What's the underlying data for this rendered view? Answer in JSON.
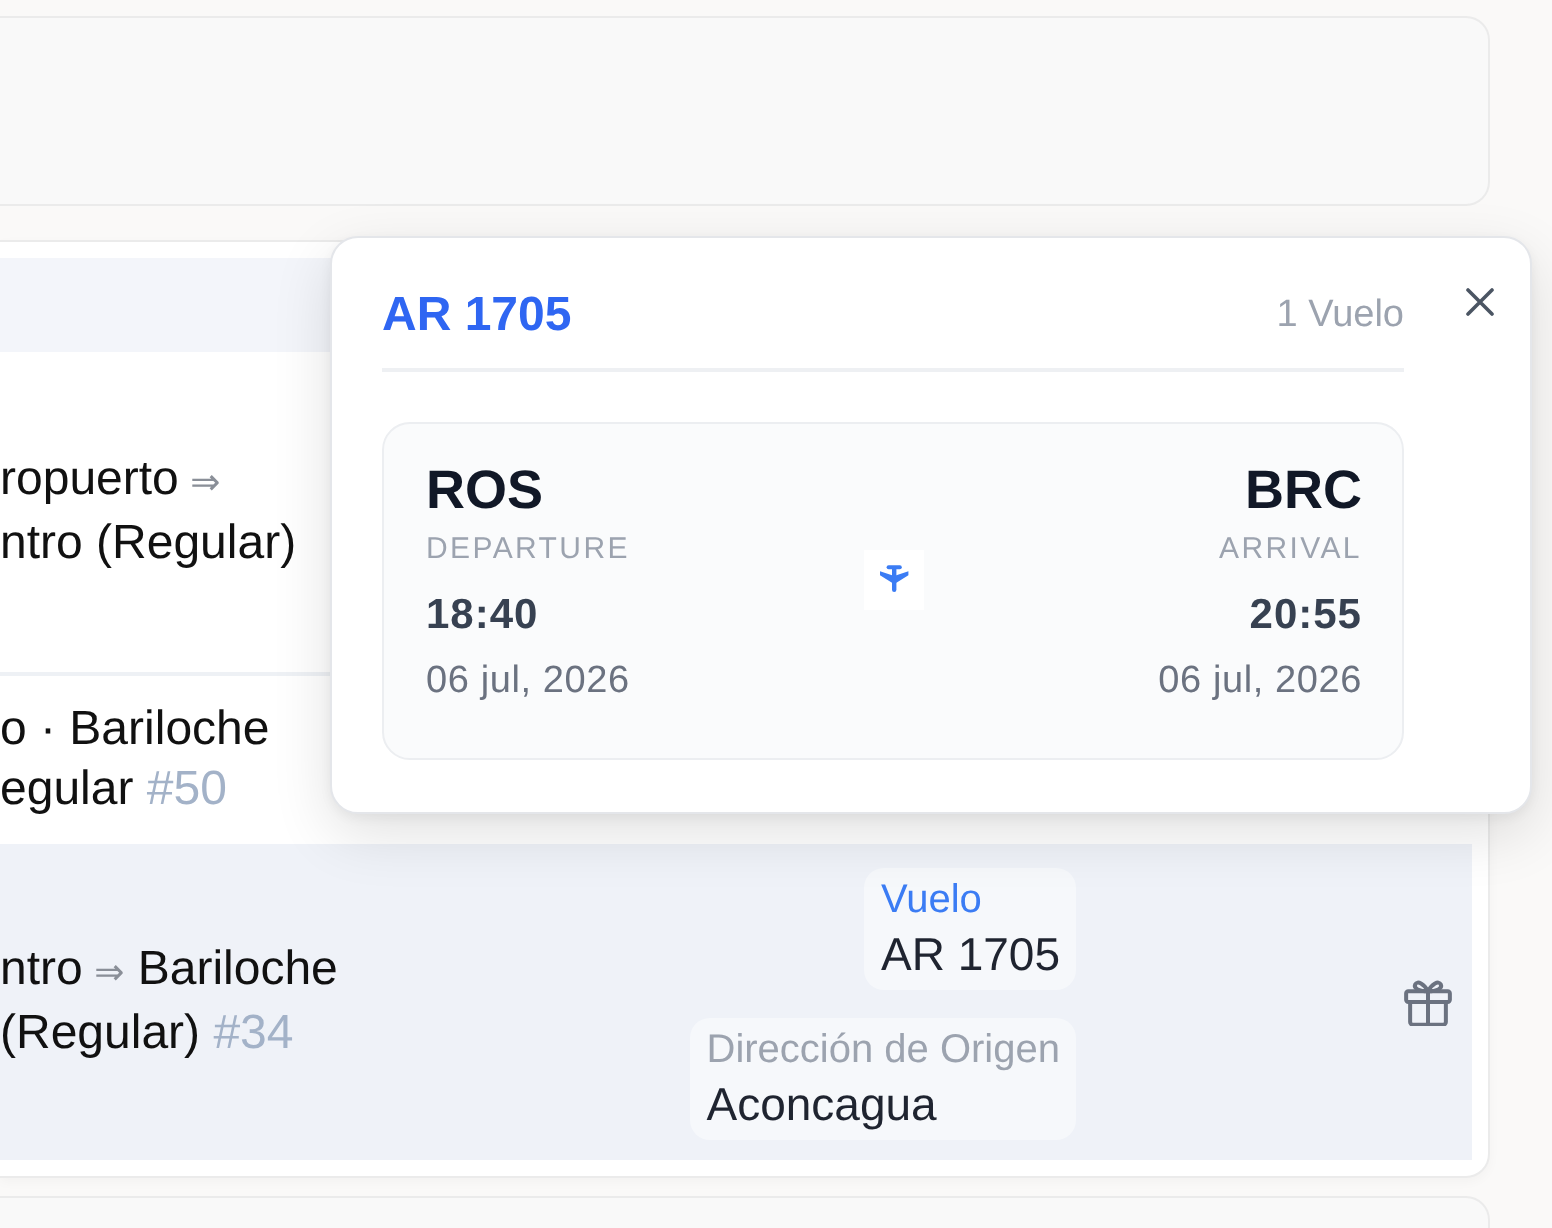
{
  "table": {
    "rows": [
      {
        "selected": false,
        "title_lines": [
          [
            {
              "kind": "text",
              "text": "ropuerto"
            },
            {
              "kind": "arrow",
              "text": "⇒"
            }
          ],
          [
            {
              "kind": "text",
              "text": "ntro (Regular)"
            }
          ]
        ]
      },
      {
        "selected": false,
        "title_lines": [
          [
            {
              "kind": "text",
              "text": "o · Bariloche"
            }
          ],
          [
            {
              "kind": "text",
              "text": "egular"
            },
            {
              "kind": "ref",
              "text": "#50"
            }
          ]
        ]
      },
      {
        "selected": true,
        "title_lines": [
          [
            {
              "kind": "text",
              "text": "ntro"
            },
            {
              "kind": "arrow",
              "text": "⇒"
            },
            {
              "kind": "text",
              "text": "Bariloche"
            }
          ],
          [
            {
              "kind": "text",
              "text": "(Regular)"
            },
            {
              "kind": "ref",
              "text": "#34"
            }
          ]
        ],
        "details": {
          "chips": [
            {
              "kind": "flight",
              "label": "Vuelo",
              "value": "AR 1705"
            },
            {
              "kind": "address",
              "label": "Dirección de Origen",
              "value": "Aconcagua"
            }
          ]
        }
      }
    ]
  },
  "flight_popover": {
    "title": "AR 1705",
    "count": "1 Vuelo",
    "segment": {
      "departure": {
        "code": "ROS",
        "label": "DEPARTURE",
        "time": "18:40",
        "date": "06 jul, 2026"
      },
      "arrival": {
        "code": "BRC",
        "label": "ARRIVAL",
        "time": "20:55",
        "date": "06 jul, 2026"
      }
    }
  }
}
